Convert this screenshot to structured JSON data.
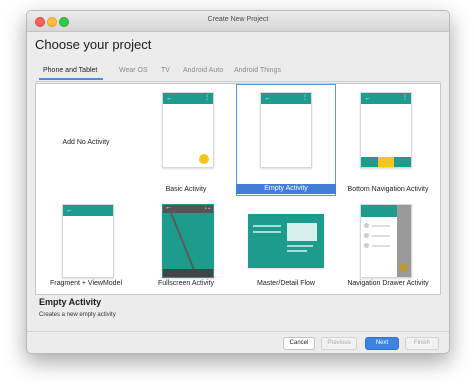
{
  "window": {
    "title": "Create New Project"
  },
  "page": {
    "heading": "Choose your project"
  },
  "tabs": [
    {
      "label": "Phone and Tablet",
      "active": true
    },
    {
      "label": "Wear OS",
      "active": false
    },
    {
      "label": "TV",
      "active": false
    },
    {
      "label": "Android Auto",
      "active": false
    },
    {
      "label": "Android Things",
      "active": false
    }
  ],
  "templates": [
    {
      "label": "Add No Activity"
    },
    {
      "label": "Basic Activity"
    },
    {
      "label": "Empty Activity",
      "selected": true
    },
    {
      "label": "Bottom Navigation Activity"
    },
    {
      "label": "Fragment + ViewModel"
    },
    {
      "label": "Fullscreen Activity"
    },
    {
      "label": "Master/Detail Flow"
    },
    {
      "label": "Navigation Drawer Activity"
    }
  ],
  "description": {
    "title": "Empty Activity",
    "text": "Creates a new empty activity"
  },
  "buttons": {
    "cancel": "Cancel",
    "previous": "Previous",
    "next": "Next",
    "finish": "Finish"
  },
  "colors": {
    "accent": "#1d9c8d",
    "fab": "#f5c518",
    "selection": "#3f7fd6"
  }
}
